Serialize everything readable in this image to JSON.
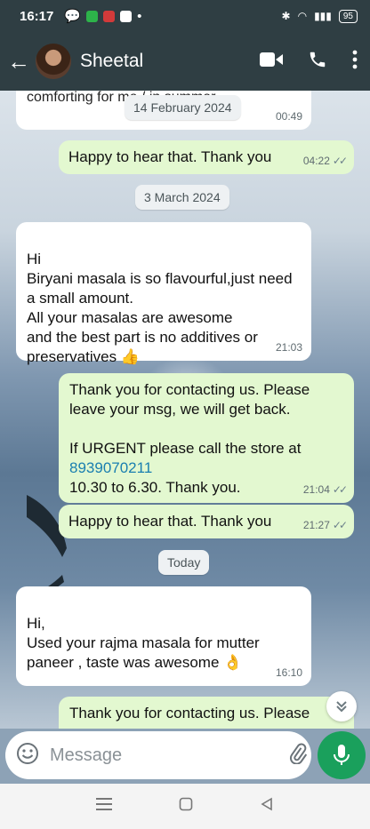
{
  "status_bar": {
    "time": "16:17",
    "battery": "95"
  },
  "header": {
    "contact_name": "Sheetal"
  },
  "messages": {
    "partial_top_text": "comforting for me / in summer",
    "date_1": "14 February 2024",
    "m0_time": "00:49",
    "m1_text": "Happy to hear that. Thank you",
    "m1_time": "04:22",
    "date_2": "3 March 2024",
    "m2_text": "Hi\nBiryani masala is so flavourful,just need a small amount.\nAll your masalas are awesome\nand the best part is no additives or preservatives 👍",
    "m2_time": "21:03",
    "m3_line1": "Thank you for contacting us. Please leave your msg, we will get back.",
    "m3_line2": "If URGENT please call the store at",
    "m3_phone": "8939070211",
    "m3_line3": "10.30 to 6.30. Thank you.",
    "m3_time": "21:04",
    "m4_text": "Happy to hear that. Thank you",
    "m4_time": "21:27",
    "date_3": "Today",
    "m5_text": "Hi,\nUsed your rajma masala for mutter paneer , taste was awesome 👌",
    "m5_time": "16:10",
    "m6_text": "Thank you for contacting us. Please"
  },
  "input": {
    "placeholder": "Message"
  },
  "colors": {
    "header_bg": "#2f3e43",
    "outgoing_bubble": "#e3f8d0",
    "accent_green": "#1aa05c",
    "link": "#1a7fb0"
  }
}
